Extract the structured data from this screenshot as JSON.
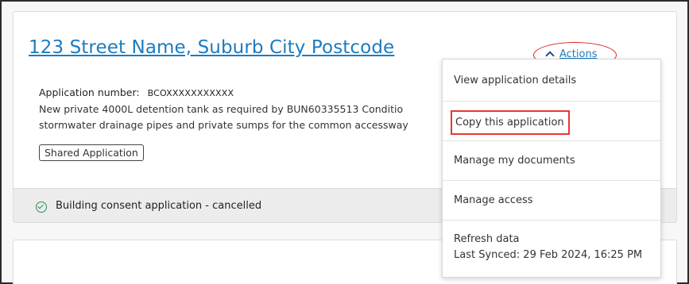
{
  "application": {
    "address": "123 Street Name, Suburb City Postcode",
    "number_label": "Application number:",
    "number_value": "BCOXXXXXXXXXXX",
    "description_line1": "New private 4000L detention tank as required by BUN60335513 Conditio",
    "description_line2": "stormwater drainage pipes and private sumps for the common accessway",
    "badge": "Shared Application",
    "status": "Building consent application - cancelled"
  },
  "actions": {
    "label": "Actions"
  },
  "menu": {
    "items": [
      {
        "label": "View application details"
      },
      {
        "label": "Copy this application"
      },
      {
        "label": "Manage my documents"
      },
      {
        "label": "Manage access"
      },
      {
        "label": "Refresh data"
      }
    ],
    "last_synced": "Last Synced: 29 Feb 2024, 16:25 PM"
  },
  "colors": {
    "link": "#1e7bbf",
    "highlight": "#e53935",
    "status_ok": "#2e8b57"
  }
}
